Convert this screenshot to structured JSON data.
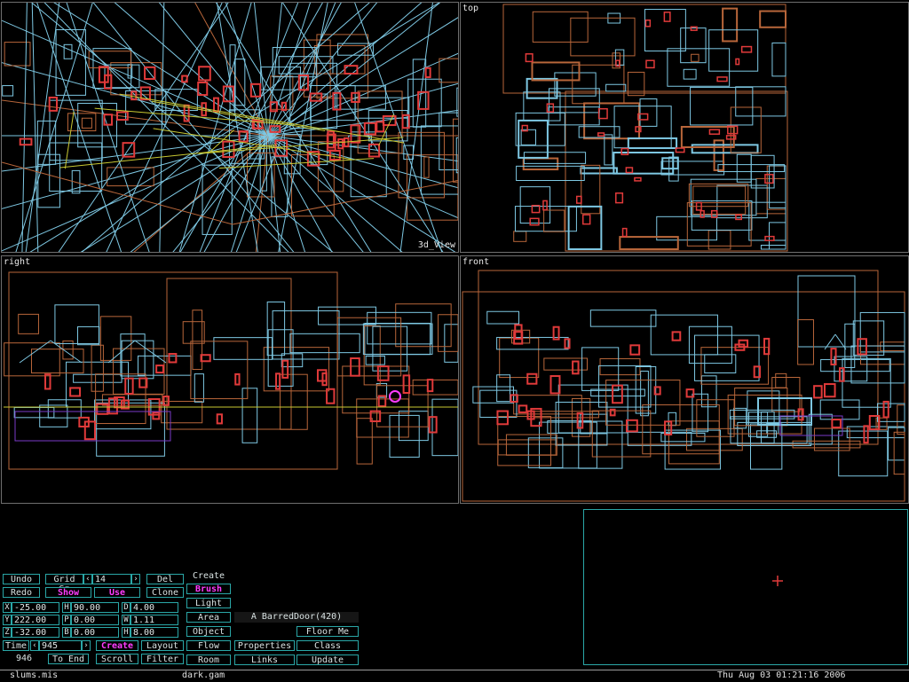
{
  "viewports": {
    "perspective": {
      "label": "3d_View"
    },
    "top": {
      "label": "top"
    },
    "right": {
      "label": "right"
    },
    "front": {
      "label": "front"
    }
  },
  "toolbar": {
    "undo": "Undo",
    "redo": "Redo",
    "grid_size_label": "Grid Sz",
    "grid_size_value": "14",
    "del": "Del",
    "clone": "Clone",
    "show": "Show",
    "use": "Use",
    "coords": [
      {
        "axis": "X",
        "value": "-25.00",
        "rot_axis": "H",
        "rot_value": "90.00",
        "dim_axis": "D",
        "dim_value": "4.00"
      },
      {
        "axis": "Y",
        "value": "222.00",
        "rot_axis": "P",
        "rot_value": "0.00",
        "dim_axis": "W",
        "dim_value": "1.11"
      },
      {
        "axis": "Z",
        "value": "-32.00",
        "rot_axis": "B",
        "rot_value": "0.00",
        "dim_axis": "H",
        "dim_value": "8.00"
      }
    ],
    "time_label": "Time",
    "time_value": "945",
    "frame_count": "946",
    "to_end": "To End",
    "scroll": "Scroll",
    "create_mode": "Create",
    "layout": "Layout",
    "filter": "Filter",
    "create_header": "Create",
    "brush": "Brush",
    "light": "Light",
    "area": "Area",
    "object": "Object",
    "flow": "Flow",
    "room": "Room",
    "selected_object": "A BarredDoor(420)",
    "properties": "Properties",
    "links": "Links",
    "floor_me": "Floor Me",
    "class": "Class",
    "update": "Update"
  },
  "status": {
    "mission": "slums.mis",
    "gamefile": "dark.gam",
    "datetime": "Thu Aug 03 01:21:16 2006"
  },
  "colors": {
    "wire_cyan": "#7ec8e3",
    "wire_orange": "#b8663a",
    "wire_red": "#e03a3a",
    "wire_yellow": "#c8c832",
    "accent_magenta": "#ff3cff",
    "button_border": "#2aa7a7"
  }
}
